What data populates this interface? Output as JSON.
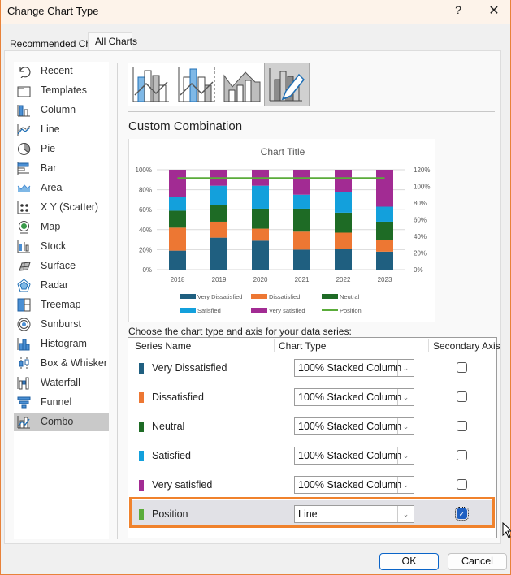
{
  "window": {
    "title": "Change Chart Type",
    "help_label": "?",
    "close_label": "✕"
  },
  "tabs": [
    {
      "label": "Recommended Charts",
      "active": false
    },
    {
      "label": "All Charts",
      "active": true
    }
  ],
  "sidebar": {
    "items": [
      {
        "label": "Recent",
        "icon": "recent-icon"
      },
      {
        "label": "Templates",
        "icon": "templates-icon"
      },
      {
        "label": "Column",
        "icon": "column-chart-icon"
      },
      {
        "label": "Line",
        "icon": "line-chart-icon"
      },
      {
        "label": "Pie",
        "icon": "pie-chart-icon"
      },
      {
        "label": "Bar",
        "icon": "bar-chart-icon"
      },
      {
        "label": "Area",
        "icon": "area-chart-icon"
      },
      {
        "label": "X Y (Scatter)",
        "icon": "scatter-chart-icon"
      },
      {
        "label": "Map",
        "icon": "map-chart-icon"
      },
      {
        "label": "Stock",
        "icon": "stock-chart-icon"
      },
      {
        "label": "Surface",
        "icon": "surface-chart-icon"
      },
      {
        "label": "Radar",
        "icon": "radar-chart-icon"
      },
      {
        "label": "Treemap",
        "icon": "treemap-chart-icon"
      },
      {
        "label": "Sunburst",
        "icon": "sunburst-chart-icon"
      },
      {
        "label": "Histogram",
        "icon": "histogram-chart-icon"
      },
      {
        "label": "Box & Whisker",
        "icon": "box-whisker-chart-icon"
      },
      {
        "label": "Waterfall",
        "icon": "waterfall-chart-icon"
      },
      {
        "label": "Funnel",
        "icon": "funnel-chart-icon"
      },
      {
        "label": "Combo",
        "icon": "combo-chart-icon",
        "active": true
      }
    ]
  },
  "subtypes": [
    {
      "name": "clustered-column-line",
      "active": false
    },
    {
      "name": "clustered-column-line-secondary-axis",
      "active": false
    },
    {
      "name": "stacked-area-clustered-column",
      "active": false
    },
    {
      "name": "custom-combination",
      "active": true
    }
  ],
  "section_title": "Custom Combination",
  "colors": {
    "very_dissatisfied": "#1f5f80",
    "dissatisfied": "#ed7733",
    "neutral": "#1e6b25",
    "satisfied": "#13a0dc",
    "very_satisfied": "#a22b93",
    "position": "#5aac3a",
    "highlight": "#f0822c",
    "accent": "#1e5fc1"
  },
  "chart_data": {
    "type": "bar",
    "stacking": "percent",
    "title": "Chart Title",
    "categories": [
      "2018",
      "2019",
      "2020",
      "2021",
      "2022",
      "2023"
    ],
    "series": [
      {
        "name": "Very Dissatisfied",
        "values": [
          19,
          32,
          29,
          20,
          21,
          18
        ],
        "color": "#1f5f80"
      },
      {
        "name": "Dissatisfied",
        "values": [
          23,
          16,
          12,
          18,
          16,
          12
        ],
        "color": "#ed7733"
      },
      {
        "name": "Neutral",
        "values": [
          17,
          17,
          20,
          23,
          20,
          18
        ],
        "color": "#1e6b25"
      },
      {
        "name": "Satisfied",
        "values": [
          14,
          19,
          23,
          14,
          21,
          15
        ],
        "color": "#13a0dc"
      },
      {
        "name": "Very satisfied",
        "values": [
          27,
          16,
          16,
          25,
          22,
          37
        ],
        "color": "#a22b93"
      }
    ],
    "line_series": {
      "name": "Position",
      "type": "line",
      "axis": "secondary",
      "values": [
        110,
        110,
        110,
        110,
        110,
        110
      ],
      "color": "#5aac3a"
    },
    "y_primary": {
      "ticks": [
        "0%",
        "20%",
        "40%",
        "60%",
        "80%",
        "100%"
      ],
      "range": [
        0,
        100
      ]
    },
    "y_secondary": {
      "ticks": [
        "0%",
        "20%",
        "40%",
        "60%",
        "80%",
        "100%",
        "120%"
      ],
      "range": [
        0,
        120
      ]
    },
    "legend": {
      "placement": "bottom",
      "entries": [
        "Very Dissatisfied",
        "Dissatisfied",
        "Neutral",
        "Satisfied",
        "Very satisfied",
        "Position"
      ]
    },
    "grid": true
  },
  "series_table": {
    "prompt": "Choose the chart type and axis for your data series:",
    "headers": {
      "name": "Series Name",
      "type": "Chart Type",
      "axis": "Secondary Axis"
    },
    "rows": [
      {
        "name": "Very Dissatisfied",
        "chart_type": "100% Stacked Column",
        "secondary_axis": false,
        "color": "#1f5f80"
      },
      {
        "name": "Dissatisfied",
        "chart_type": "100% Stacked Column",
        "secondary_axis": false,
        "color": "#ed7733"
      },
      {
        "name": "Neutral",
        "chart_type": "100% Stacked Column",
        "secondary_axis": false,
        "color": "#1e6b25"
      },
      {
        "name": "Satisfied",
        "chart_type": "100% Stacked Column",
        "secondary_axis": false,
        "color": "#13a0dc"
      },
      {
        "name": "Very satisfied",
        "chart_type": "100% Stacked Column",
        "secondary_axis": false,
        "color": "#a22b93"
      },
      {
        "name": "Position",
        "chart_type": "Line",
        "secondary_axis": true,
        "color": "#5aac3a",
        "selected": true
      }
    ]
  },
  "buttons": {
    "ok": "OK",
    "cancel": "Cancel"
  }
}
